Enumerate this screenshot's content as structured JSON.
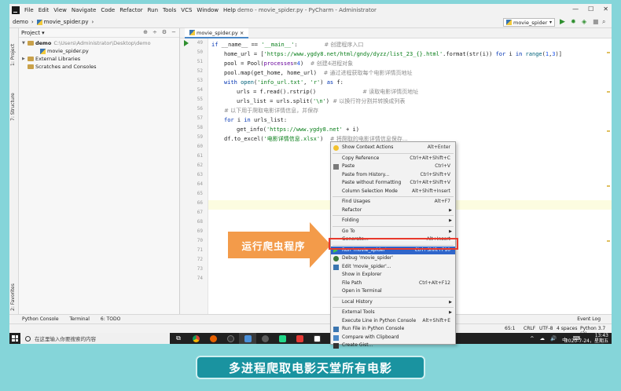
{
  "window": {
    "title": "demo - movie_spider.py - PyCharm - Administrator",
    "menu": [
      "File",
      "Edit",
      "View",
      "Navigate",
      "Code",
      "Refactor",
      "Run",
      "Tools",
      "VCS",
      "Window",
      "Help"
    ],
    "controls": [
      "—",
      "☐",
      "✕"
    ]
  },
  "navbar": {
    "crumbs": [
      "demo",
      "›",
      "movie_spider.py",
      "›"
    ],
    "run_config": "movie_spider"
  },
  "side_tabs": {
    "project": "1: Project",
    "structure": "7: Structure",
    "favorites": "2: Favorites"
  },
  "project": {
    "header": "Project ▾",
    "tools": [
      "⊕",
      "÷",
      "⚙",
      "−"
    ],
    "tree": [
      {
        "arrow": "▼",
        "icon": "folder",
        "label": "demo",
        "extra": "C:\\Users\\Administrator\\Desktop\\demo",
        "indent": 0
      },
      {
        "arrow": "",
        "icon": "py",
        "label": "movie_spider.py",
        "extra": "",
        "indent": 1
      },
      {
        "arrow": "▶",
        "icon": "folder",
        "label": "External Libraries",
        "extra": "",
        "indent": 0
      },
      {
        "arrow": "",
        "icon": "folder",
        "label": "Scratches and Consoles",
        "extra": "",
        "indent": 0
      }
    ]
  },
  "editor": {
    "tab": "movie_spider.py ×",
    "line_numbers": [
      "49",
      "50",
      "51",
      "52",
      "53",
      "54",
      "55",
      "56",
      "57",
      "58",
      "59",
      "60",
      "61",
      "62",
      "63",
      "64",
      "65",
      "66",
      "67",
      "68",
      "69",
      "70",
      "71",
      "72",
      "73",
      "74"
    ],
    "code": [
      {
        "i": 0,
        "t": [
          [
            "kw",
            "if "
          ],
          [
            "",
            "__name__ == "
          ],
          [
            "str",
            "'__main__'"
          ],
          [
            "",
            ":        "
          ],
          [
            "cmt",
            "# 创建程序入口"
          ]
        ]
      },
      {
        "i": 1,
        "t": [
          [
            "",
            "home_url = ["
          ],
          [
            "str",
            "'https://www.ygdy8.net/html/gndy/dyzz/list_23_{}.html'"
          ],
          [
            "",
            ".format(str(i)) "
          ],
          [
            "kw",
            "for "
          ],
          [
            "",
            "i "
          ],
          [
            "kw",
            "in "
          ],
          [
            "fn",
            "range"
          ],
          [
            "",
            "("
          ],
          [
            "num",
            "1"
          ],
          [
            "",
            ","
          ],
          [
            "num",
            "3"
          ],
          [
            "",
            ")]"
          ]
        ]
      },
      {
        "i": 1,
        "t": [
          [
            "",
            "pool = Pool("
          ],
          [
            "param",
            "processes"
          ],
          [
            "",
            "="
          ],
          [
            "num",
            "4"
          ],
          [
            "",
            ")  "
          ],
          [
            "cmt",
            "# 创建4进程对象"
          ]
        ]
      },
      {
        "i": 1,
        "t": [
          [
            "",
            "pool.map(get_home, home_url)  "
          ],
          [
            "cmt",
            "# 通过进程获取每个电影详情页地址"
          ]
        ]
      },
      {
        "i": 1,
        "t": [
          [
            "kw",
            "with "
          ],
          [
            "fn",
            "open"
          ],
          [
            "",
            "("
          ],
          [
            "str",
            "'info_url.txt'"
          ],
          [
            "",
            ", "
          ],
          [
            "str",
            "'r'"
          ],
          [
            "",
            ") "
          ],
          [
            "kw",
            "as "
          ],
          [
            "",
            "f:"
          ]
        ]
      },
      {
        "i": 2,
        "t": [
          [
            "",
            "urls = f.read().rstrip()              "
          ],
          [
            "cmt",
            "# 读取电影详情页地址"
          ]
        ]
      },
      {
        "i": 2,
        "t": [
          [
            "",
            "urls_list = urls.split("
          ],
          [
            "str",
            "'\\n'"
          ],
          [
            "",
            ") "
          ],
          [
            "cmt",
            "# 以换行符分割并转换成列表"
          ]
        ]
      },
      {
        "i": 1,
        "t": [
          [
            "cmt",
            "# 以下用于爬取电影详情信息，并保存"
          ]
        ]
      },
      {
        "i": 1,
        "t": [
          [
            "kw",
            "for "
          ],
          [
            "",
            "i "
          ],
          [
            "kw",
            "in "
          ],
          [
            "",
            "urls_list:"
          ]
        ]
      },
      {
        "i": 2,
        "t": [
          [
            "",
            "get_info("
          ],
          [
            "str",
            "'https://www.ygdy8.net'"
          ],
          [
            "",
            " + i)"
          ]
        ]
      },
      {
        "i": 1,
        "t": [
          [
            "",
            "df.to_excel("
          ],
          [
            "str",
            "'电影详情信息.xlsx'"
          ],
          [
            "",
            ")  "
          ],
          [
            "cmt",
            "# 将爬取的电影详情信息保存..."
          ]
        ]
      }
    ]
  },
  "context_menu": [
    {
      "label": "Show Context Actions",
      "sc": "Alt+Enter",
      "icon": "bulb"
    },
    {
      "sep": true
    },
    {
      "label": "Copy Reference",
      "sc": "Ctrl+Alt+Shift+C"
    },
    {
      "label": "Paste",
      "sc": "Ctrl+V",
      "icon": "paste"
    },
    {
      "label": "Paste from History...",
      "sc": "Ctrl+Shift+V"
    },
    {
      "label": "Paste without Formatting",
      "sc": "Ctrl+Alt+Shift+V"
    },
    {
      "label": "Column Selection Mode",
      "sc": "Alt+Shift+Insert"
    },
    {
      "sep": true
    },
    {
      "label": "Find Usages",
      "sc": "Alt+F7"
    },
    {
      "label": "Refactor",
      "sub": true
    },
    {
      "sep": true
    },
    {
      "label": "Folding",
      "sub": true
    },
    {
      "sep": true
    },
    {
      "label": "Go To",
      "sub": true
    },
    {
      "label": "Generate...",
      "sc": "Alt+Insert"
    },
    {
      "sep": true
    },
    {
      "label": "Run 'movie_spider'",
      "sc": "Ctrl+Shift+F10",
      "icon": "run",
      "selected": true
    },
    {
      "label": "Debug 'movie_spider'",
      "icon": "debug"
    },
    {
      "label": "Edit 'movie_spider'...",
      "icon": "py"
    },
    {
      "label": "Show in Explorer"
    },
    {
      "label": "File Path",
      "sc": "Ctrl+Alt+F12"
    },
    {
      "label": "Open in Terminal"
    },
    {
      "sep": true
    },
    {
      "label": "Local History",
      "sub": true
    },
    {
      "sep": true
    },
    {
      "label": "External Tools",
      "sub": true
    },
    {
      "label": "Execute Line in Python Console",
      "sc": "Alt+Shift+E"
    },
    {
      "label": "Run File in Python Console",
      "icon": "py"
    },
    {
      "label": "Compare with Clipboard",
      "icon": "cmp"
    },
    {
      "label": "Create Gist...",
      "icon": "gist"
    }
  ],
  "annotation": {
    "label": "运行爬虫程序"
  },
  "bottom_tabs": [
    "Python Console",
    "Terminal",
    "6: TODO"
  ],
  "status": {
    "position": "65:1",
    "line_sep": "CRLF",
    "encoding": "UTF-8",
    "indent": "4 spaces",
    "interpreter": "Python 3.7 (3)",
    "event_log": "Event Log"
  },
  "taskbar": {
    "search_placeholder": "在这里输入你要搜索的内容",
    "tray": [
      "^",
      "☁",
      "🔊",
      "中",
      "⌨"
    ],
    "time": "13:43",
    "date": "2020-7-24，星期五"
  },
  "caption": "多进程爬取电影天堂所有电影",
  "colors": {
    "background": "#85d5d9",
    "selection": "#2f65ca",
    "highlight_box": "#e8392c",
    "arrow": "#f39b4a",
    "caption": "#1a93a0"
  }
}
